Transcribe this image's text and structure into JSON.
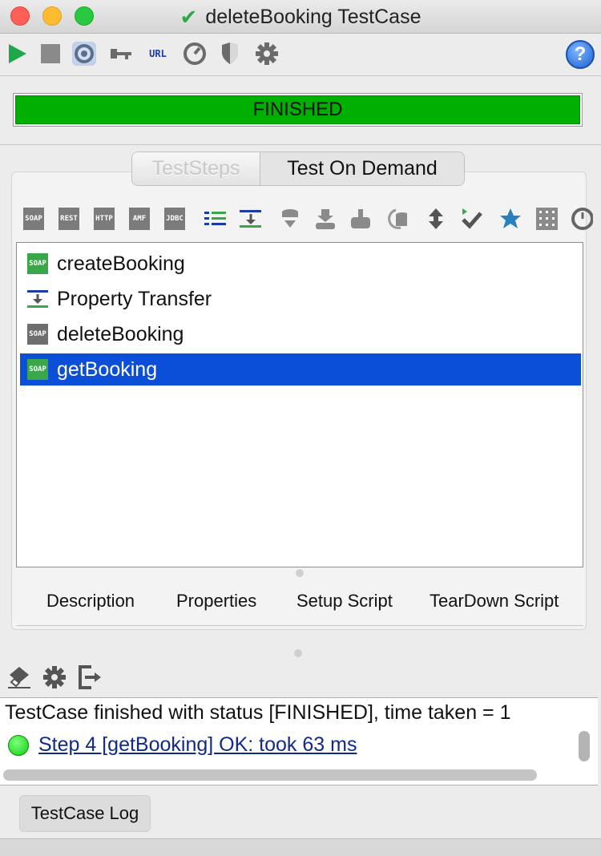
{
  "window": {
    "title": "deleteBooking TestCase",
    "title_icon": "check-icon",
    "buttons": [
      "close",
      "minimize",
      "maximize"
    ]
  },
  "toolbar": {
    "icons": [
      "run-icon",
      "stop-icon",
      "options-icon",
      "credentials-icon",
      "url-icon",
      "load-test-icon",
      "security-test-icon",
      "settings-icon"
    ],
    "url_label": "URL",
    "help_label": "?"
  },
  "progress": {
    "label": "FINISHED",
    "value": 1.0,
    "color": "#00b000"
  },
  "tabs": {
    "teststeps": "TestSteps",
    "on_demand": "Test On Demand"
  },
  "step_toolbar": {
    "boxes": [
      {
        "name": "soap-step-icon",
        "l1": "SO",
        "l2": "AP"
      },
      {
        "name": "rest-step-icon",
        "l1": "RE",
        "l2": "ST"
      },
      {
        "name": "http-step-icon",
        "l1": "HT",
        "l2": "TP"
      },
      {
        "name": "amf-step-icon",
        "l1": "A",
        "l2": "MF"
      },
      {
        "name": "jdbc-step-icon",
        "l1": "JD",
        "l2": "BC"
      }
    ]
  },
  "steps": [
    {
      "label": "createBooking",
      "icon": "soap-step-icon",
      "color": "green",
      "l1": "SO",
      "l2": "AP"
    },
    {
      "label": "Property Transfer",
      "icon": "property-transfer-icon"
    },
    {
      "label": "deleteBooking",
      "icon": "soap-step-icon",
      "color": "gray",
      "l1": "SO",
      "l2": "AP"
    },
    {
      "label": "getBooking",
      "icon": "soap-step-icon",
      "color": "green",
      "l1": "SO",
      "l2": "AP",
      "selected": true
    }
  ],
  "bottom_tabs": [
    "Description",
    "Properties",
    "Setup Script",
    "TearDown Script"
  ],
  "log": {
    "line1": "TestCase finished with status [FINISHED], time taken = 1",
    "line2": "Step 4 [getBooking] OK: took 63 ms",
    "tab": "TestCase Log"
  },
  "colors": {
    "selection": "#0b4fd8",
    "progress": "#00b000",
    "ok": "#10d010"
  }
}
